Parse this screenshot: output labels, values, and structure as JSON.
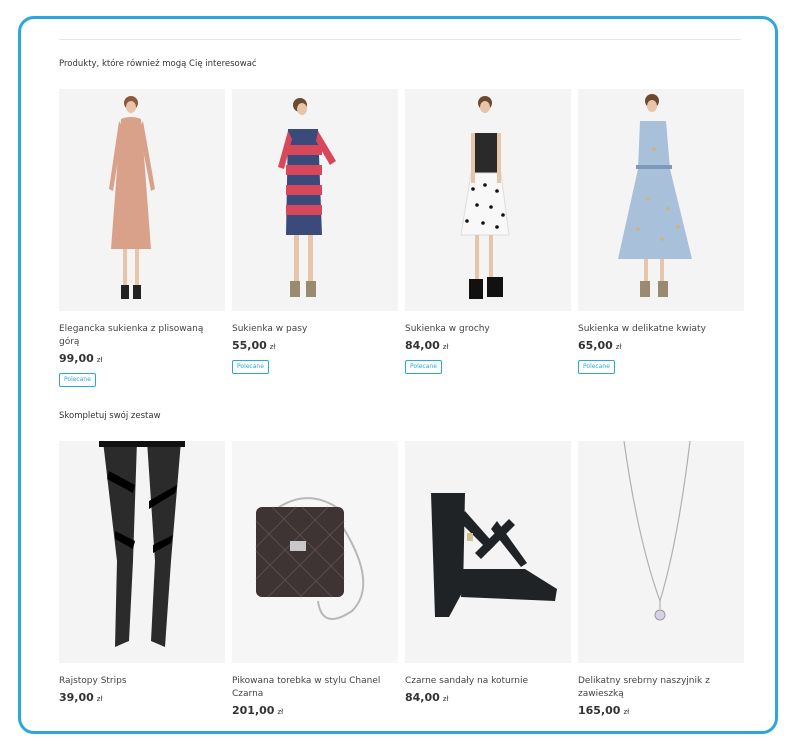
{
  "sections": [
    {
      "title": "Produkty, które również mogą Cię interesować",
      "products": [
        {
          "name": "Elegancka sukienka z plisowaną górą",
          "price": "99,00",
          "currency": "zł",
          "badge": "Polecane",
          "image": "model-pink-dress"
        },
        {
          "name": "Sukienka w pasy",
          "price": "55,00",
          "currency": "zł",
          "badge": "Polecane",
          "image": "model-striped-dress"
        },
        {
          "name": "Sukienka w grochy",
          "price": "84,00",
          "currency": "zł",
          "badge": "Polecane",
          "image": "model-polka-dot-dress"
        },
        {
          "name": "Sukienka w delikatne kwiaty",
          "price": "65,00",
          "currency": "zł",
          "badge": "Polecane",
          "image": "model-floral-dress"
        }
      ]
    },
    {
      "title": "Skompletuj swój zestaw",
      "products": [
        {
          "name": "Rajstopy Strips",
          "price": "39,00",
          "currency": "zł",
          "image": "black-tights"
        },
        {
          "name": "Pikowana torebka w stylu Chanel Czarna",
          "price": "201,00",
          "currency": "zł",
          "image": "quilted-handbag"
        },
        {
          "name": "Czarne sandały na koturnie",
          "price": "84,00",
          "currency": "zł",
          "image": "wedge-sandal"
        },
        {
          "name": "Delikatny srebrny naszyjnik z zawieszką",
          "price": "165,00",
          "currency": "zł",
          "image": "silver-necklace"
        }
      ]
    }
  ],
  "colors": {
    "accent": "#2ba7de",
    "frame_border": "#2ba7de",
    "text": "#333333"
  }
}
